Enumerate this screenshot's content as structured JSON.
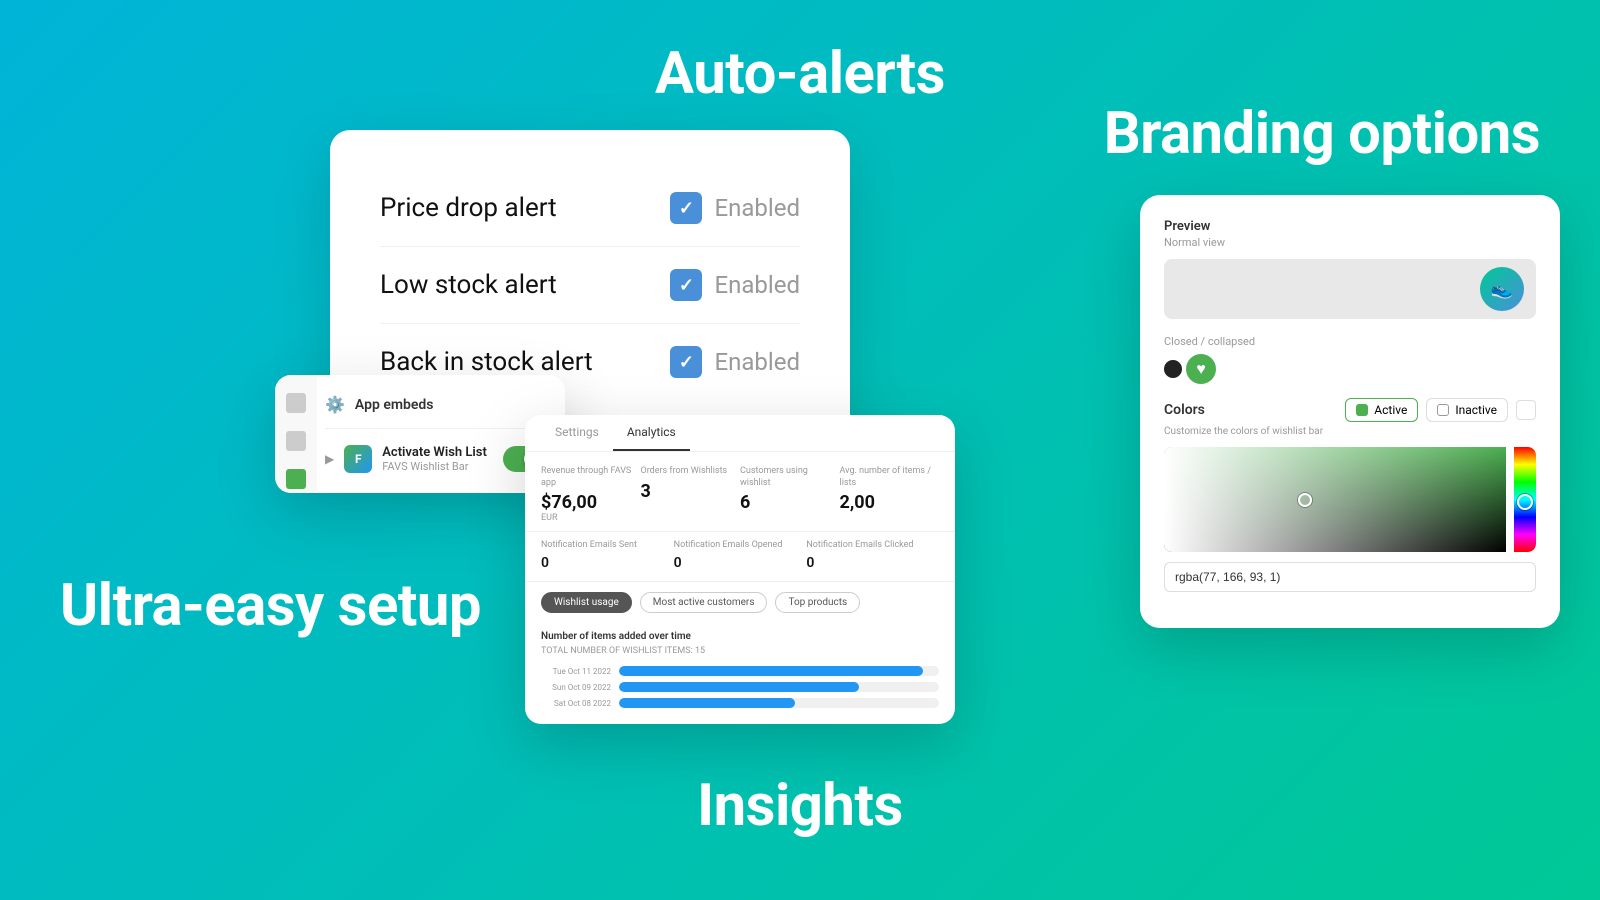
{
  "background": {
    "gradient_start": "#00b4d8",
    "gradient_end": "#00c896"
  },
  "labels": {
    "auto_alerts": "Auto-alerts",
    "branding": "Branding options",
    "setup": "Ultra-easy setup",
    "insights": "Insights"
  },
  "alerts_card": {
    "rows": [
      {
        "name": "Price drop alert",
        "status": "Enabled"
      },
      {
        "name": "Low stock alert",
        "status": "Enabled"
      },
      {
        "name": "Back in stock alert",
        "status": "Enabled"
      }
    ]
  },
  "branding_card": {
    "preview_label": "Preview",
    "preview_sublabel": "Normal view",
    "collapsed_label": "Closed / collapsed",
    "colors_title": "Colors",
    "colors_desc": "Customize the colors of wishlist bar",
    "active_label": "Active",
    "inactive_label": "Inactive",
    "color_value": "rgba(77, 166, 93, 1)"
  },
  "embeds_card": {
    "title": "App embeds",
    "embed_name": "Activate Wish List",
    "embed_sub": "FAVS Wishlist Bar"
  },
  "analytics_card": {
    "tabs": [
      "Settings",
      "Analytics"
    ],
    "active_tab": "Analytics",
    "stats": [
      {
        "label": "Revenue through FAVS app",
        "value": "$76,00",
        "sub": "EUR"
      },
      {
        "label": "Orders from Wishlists",
        "value": "3",
        "sub": ""
      },
      {
        "label": "Customers using wishlist",
        "value": "6",
        "sub": ""
      },
      {
        "label": "Avg. number of items / lists",
        "value": "2,00",
        "sub": ""
      }
    ],
    "row2": [
      {
        "label": "Notification Emails Sent",
        "value": "0"
      },
      {
        "label": "Notification Emails Opened",
        "value": "0"
      },
      {
        "label": "Notification Emails Clicked",
        "value": "0"
      }
    ],
    "filter_tabs": [
      "Wishlist usage",
      "Most active customers",
      "Top products"
    ],
    "active_filter": "Wishlist usage",
    "chart_title": "Number of items added over time",
    "chart_subtitle": "TOTAL NUMBER OF WISHLIST ITEMS: 15",
    "chart_rows": [
      {
        "date": "Tue Oct 11 2022",
        "pct": 95
      },
      {
        "date": "Sun Oct 09 2022",
        "pct": 75
      },
      {
        "date": "Sat Oct 08 2022",
        "pct": 55
      }
    ]
  }
}
